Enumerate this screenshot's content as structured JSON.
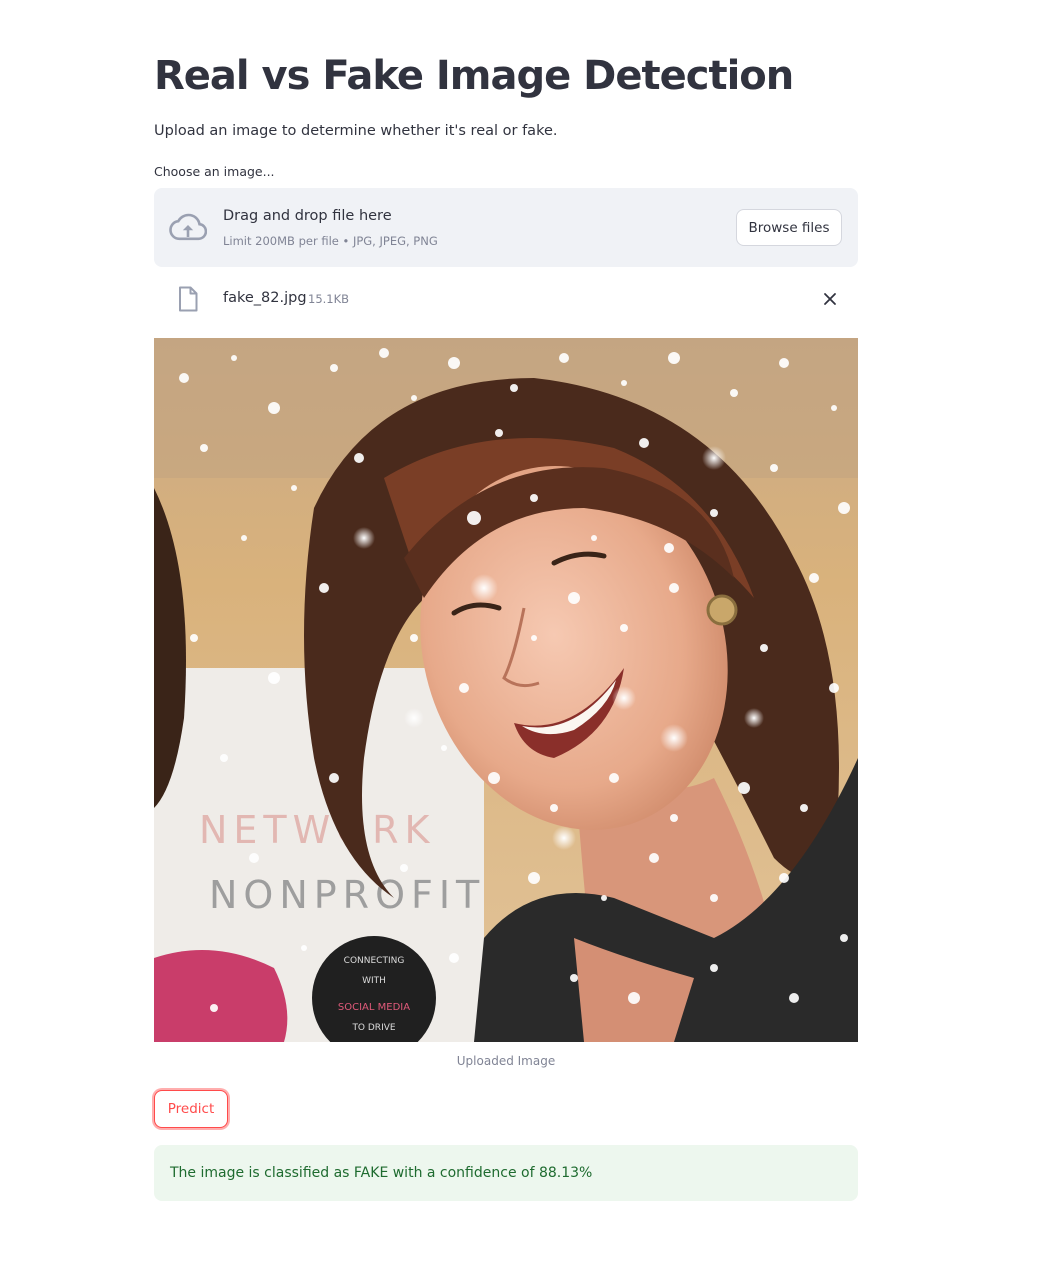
{
  "page": {
    "title": "Real vs Fake Image Detection",
    "subtitle": "Upload an image to determine whether it's real or fake."
  },
  "uploader": {
    "label": "Choose an image...",
    "drop_title": "Drag and drop file here",
    "limit_text": "Limit 200MB per file • JPG, JPEG, PNG",
    "browse_label": "Browse files",
    "icon": "cloud-upload-icon"
  },
  "uploaded_file": {
    "name": "fake_82.jpg",
    "size": "15.1KB",
    "icon": "file-icon",
    "remove_icon": "close-icon"
  },
  "image": {
    "caption": "Uploaded Image",
    "overlay_text_lines": [
      "NETWORK",
      "NONPROFIT"
    ],
    "badge_text_lines": [
      "CONNECTING",
      "WITH",
      "SOCIAL MEDIA",
      "TO DRIVE"
    ]
  },
  "predict_button": {
    "label": "Predict"
  },
  "result": {
    "text": "The image is classified as FAKE with a confidence of 88.13%"
  },
  "colors": {
    "primary": "#ff4b4b",
    "text": "#31333f",
    "muted": "#808495",
    "dropzone_bg": "#f0f2f6",
    "success_bg": "#edf7ee",
    "success_text": "#1e6b2f"
  }
}
